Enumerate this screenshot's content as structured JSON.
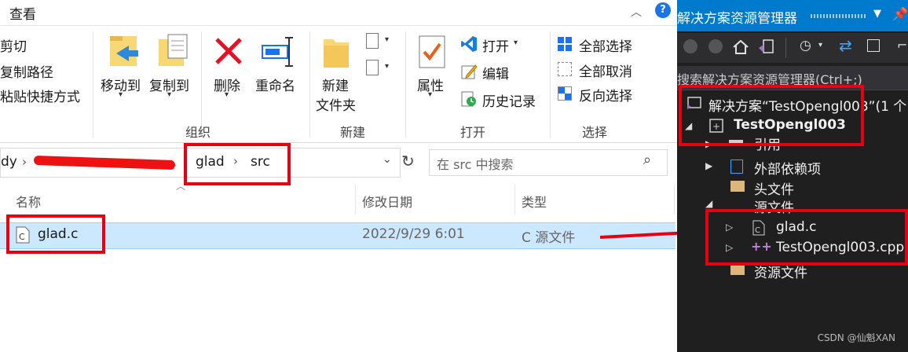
{
  "explorer": {
    "tab_title": "查看",
    "ribbon": {
      "clipboard": {
        "cut": "剪切",
        "copy_path": "复制路径",
        "paste_shortcut": "粘贴快捷方式"
      },
      "organize": {
        "group": "组织",
        "move_to": "移动到",
        "copy_to": "复制到",
        "delete": "删除",
        "rename": "重命名"
      },
      "new": {
        "group": "新建",
        "new_folder_line1": "新建",
        "new_folder_line2": "文件夹"
      },
      "open": {
        "group": "打开",
        "properties": "属性",
        "open": "打开",
        "edit": "编辑",
        "history": "历史记录"
      },
      "select": {
        "group": "选择",
        "select_all": "全部选择",
        "select_none": "全部取消",
        "invert": "反向选择"
      }
    },
    "address": {
      "prefix": "dy",
      "crumb1": "glad",
      "crumb2": "src"
    },
    "search_placeholder": "在 src 中搜索",
    "columns": {
      "name": "名称",
      "modified": "修改日期",
      "type": "类型"
    },
    "files": [
      {
        "name": "glad.c",
        "modified": "2022/9/29 6:01",
        "type": "C 源文件"
      }
    ]
  },
  "vs": {
    "title": "解决方案资源管理器",
    "search_placeholder": "搜索解决方案资源管理器(Ctrl+;)",
    "solution": "解决方案“TestOpengl003”(1 个",
    "project": "TestOpengl003",
    "references": "引用",
    "external_deps": "外部依赖项",
    "header_files": "头文件",
    "source_files": "源文件",
    "source_items": [
      "glad.c",
      "TestOpengl003.cpp"
    ],
    "resource_files": "资源文件"
  },
  "watermark": "CSDN @仙魁XAN",
  "colors": {
    "accent": "#007acc",
    "annotation_red": "#e60012",
    "selection": "#cce8ff"
  }
}
